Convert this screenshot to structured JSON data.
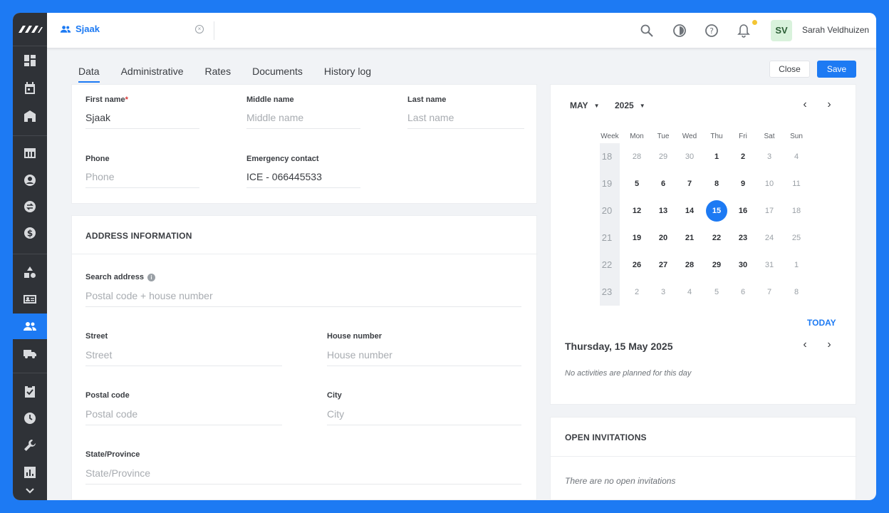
{
  "app": {
    "open_tab": {
      "label": "Sjaak",
      "icon": "people-icon"
    },
    "user": {
      "initials": "SV",
      "name": "Sarah Veldhuizen"
    },
    "topbar_icons": [
      "search-icon",
      "theme-icon",
      "help-icon",
      "bell-icon"
    ]
  },
  "sidebar": {
    "items": [
      {
        "name": "dashboard",
        "icon": "dashboard-icon"
      },
      {
        "name": "calendar",
        "icon": "calendar-icon"
      },
      {
        "name": "locations",
        "icon": "building-icon"
      },
      {
        "name": "schedule",
        "icon": "table-icon"
      },
      {
        "name": "users",
        "icon": "user-circle-icon"
      },
      {
        "name": "exchange",
        "icon": "swap-icon"
      },
      {
        "name": "finance",
        "icon": "dollar-icon"
      },
      {
        "name": "shapes",
        "icon": "shapes-icon"
      },
      {
        "name": "contacts",
        "icon": "id-card-icon"
      },
      {
        "name": "employees",
        "icon": "people-icon",
        "active": true
      },
      {
        "name": "transport",
        "icon": "truck-icon"
      },
      {
        "name": "tasks",
        "icon": "clipboard-check-icon"
      },
      {
        "name": "hours",
        "icon": "clock-icon"
      },
      {
        "name": "tools",
        "icon": "wrench-icon"
      },
      {
        "name": "reports",
        "icon": "bar-chart-icon"
      },
      {
        "name": "more",
        "icon": "chevron-down-icon"
      }
    ]
  },
  "tabs": [
    "Data",
    "Administrative",
    "Rates",
    "Documents",
    "History log"
  ],
  "actions": {
    "close": "Close",
    "save": "Save"
  },
  "personal": {
    "first_name": {
      "label": "First name",
      "required": "*",
      "value": "Sjaak"
    },
    "middle_name": {
      "label": "Middle name",
      "placeholder": "Middle name"
    },
    "last_name": {
      "label": "Last name",
      "placeholder": "Last name"
    },
    "phone": {
      "label": "Phone",
      "placeholder": "Phone"
    },
    "emergency": {
      "label": "Emergency contact",
      "value": "ICE - 066445533"
    }
  },
  "address": {
    "title": "ADDRESS INFORMATION",
    "search": {
      "label": "Search address",
      "placeholder": "Postal code + house number"
    },
    "street": {
      "label": "Street",
      "placeholder": "Street"
    },
    "house_number": {
      "label": "House number",
      "placeholder": "House number"
    },
    "postal_code": {
      "label": "Postal code",
      "placeholder": "Postal code"
    },
    "city": {
      "label": "City",
      "placeholder": "City"
    },
    "state": {
      "label": "State/Province",
      "placeholder": "State/Province"
    }
  },
  "calendar": {
    "month": "MAY",
    "year": "2025",
    "headers": [
      "Week",
      "Mon",
      "Tue",
      "Wed",
      "Thu",
      "Fri",
      "Sat",
      "Sun"
    ],
    "weeks": [
      {
        "wk": "18",
        "days": [
          {
            "d": "28",
            "o": true
          },
          {
            "d": "29",
            "o": true
          },
          {
            "d": "30",
            "o": true
          },
          {
            "d": "1"
          },
          {
            "d": "2"
          },
          {
            "d": "3",
            "o": true
          },
          {
            "d": "4",
            "o": true
          }
        ]
      },
      {
        "wk": "19",
        "days": [
          {
            "d": "5"
          },
          {
            "d": "6"
          },
          {
            "d": "7"
          },
          {
            "d": "8"
          },
          {
            "d": "9"
          },
          {
            "d": "10",
            "o": true
          },
          {
            "d": "11",
            "o": true
          }
        ]
      },
      {
        "wk": "20",
        "days": [
          {
            "d": "12"
          },
          {
            "d": "13"
          },
          {
            "d": "14"
          },
          {
            "d": "15",
            "sel": true
          },
          {
            "d": "16"
          },
          {
            "d": "17",
            "o": true
          },
          {
            "d": "18",
            "o": true
          }
        ]
      },
      {
        "wk": "21",
        "days": [
          {
            "d": "19"
          },
          {
            "d": "20"
          },
          {
            "d": "21"
          },
          {
            "d": "22"
          },
          {
            "d": "23"
          },
          {
            "d": "24",
            "o": true
          },
          {
            "d": "25",
            "o": true
          }
        ]
      },
      {
        "wk": "22",
        "days": [
          {
            "d": "26"
          },
          {
            "d": "27"
          },
          {
            "d": "28"
          },
          {
            "d": "29"
          },
          {
            "d": "30"
          },
          {
            "d": "31",
            "o": true
          },
          {
            "d": "1",
            "o": true
          }
        ]
      },
      {
        "wk": "23",
        "days": [
          {
            "d": "2",
            "o": true
          },
          {
            "d": "3",
            "o": true
          },
          {
            "d": "4",
            "o": true
          },
          {
            "d": "5",
            "o": true
          },
          {
            "d": "6",
            "o": true
          },
          {
            "d": "7",
            "o": true
          },
          {
            "d": "8",
            "o": true
          }
        ]
      }
    ],
    "today_label": "TODAY",
    "selected_day": "Thursday, 15 May 2025",
    "no_activities": "No activities are planned for this day"
  },
  "invitations": {
    "title": "OPEN INVITATIONS",
    "empty": "There are no open invitations"
  },
  "colors": {
    "accent": "#1d7af3",
    "sidebar": "#2f3237",
    "background": "#f1f3f6"
  }
}
